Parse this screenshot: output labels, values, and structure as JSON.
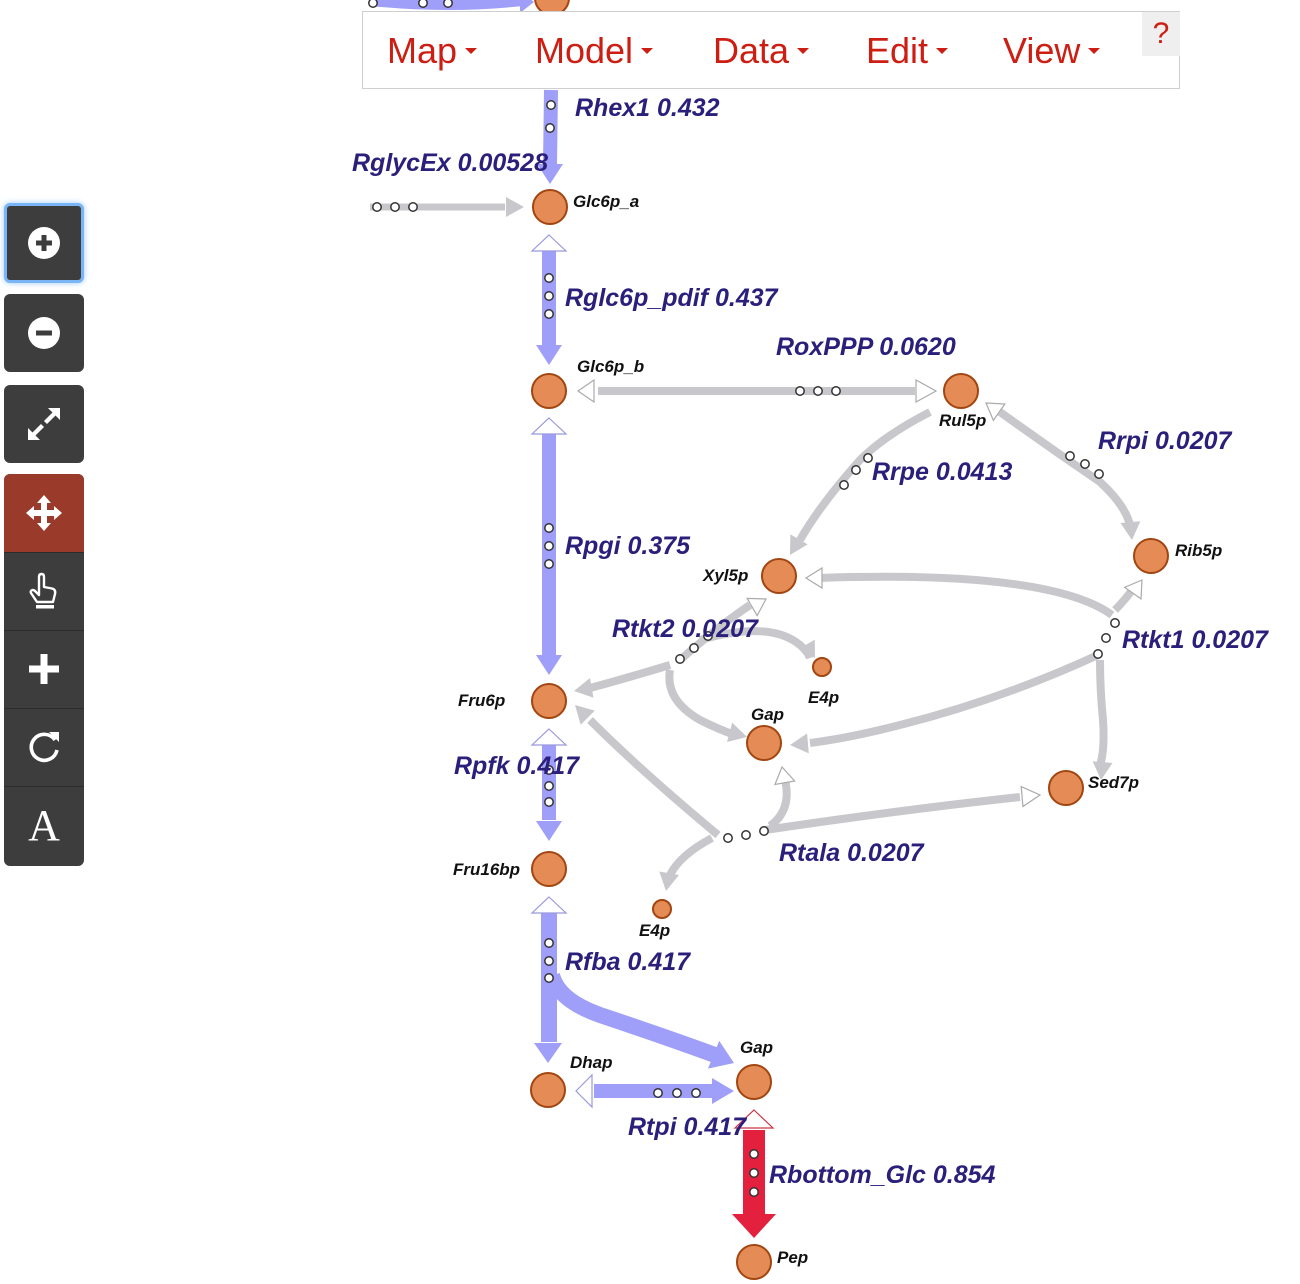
{
  "menu": {
    "items": [
      "Map",
      "Model",
      "Data",
      "Edit",
      "View"
    ],
    "help": "?"
  },
  "toolbar": {
    "text_tool": "A"
  },
  "colors": {
    "flux": "#9f9ffa",
    "inactive": "#c8c8cc",
    "highlight": "#e3203e",
    "metabolite_fill": "#e58c56",
    "metabolite_stroke": "#a24510",
    "label": "#2a1f7a",
    "menu_text": "#cc1e13"
  },
  "reactions": [
    {
      "id": "Rhex1",
      "value": "0.432"
    },
    {
      "id": "RglycEx",
      "value": "0.00528"
    },
    {
      "id": "Rglc6p_pdif",
      "value": "0.437"
    },
    {
      "id": "RoxPPP",
      "value": "0.0620"
    },
    {
      "id": "Rrpi",
      "value": "0.0207"
    },
    {
      "id": "Rrpe",
      "value": "0.0413"
    },
    {
      "id": "Rpgi",
      "value": "0.375"
    },
    {
      "id": "Rtkt2",
      "value": "0.0207"
    },
    {
      "id": "Rtkt1",
      "value": "0.0207"
    },
    {
      "id": "Rpfk",
      "value": "0.417"
    },
    {
      "id": "Rtala",
      "value": "0.0207"
    },
    {
      "id": "Rfba",
      "value": "0.417"
    },
    {
      "id": "Rtpi",
      "value": "0.417"
    },
    {
      "id": "Rbottom_Glc",
      "value": "0.854"
    }
  ],
  "metabolites": [
    "Glc6p_a",
    "Glc6p_b",
    "Rul5p",
    "Rib5p",
    "Xyl5p",
    "E4p",
    "Fru6p",
    "Gap",
    "Sed7p",
    "Fru16bp",
    "E4p",
    "Gap",
    "Dhap",
    "Pep"
  ]
}
